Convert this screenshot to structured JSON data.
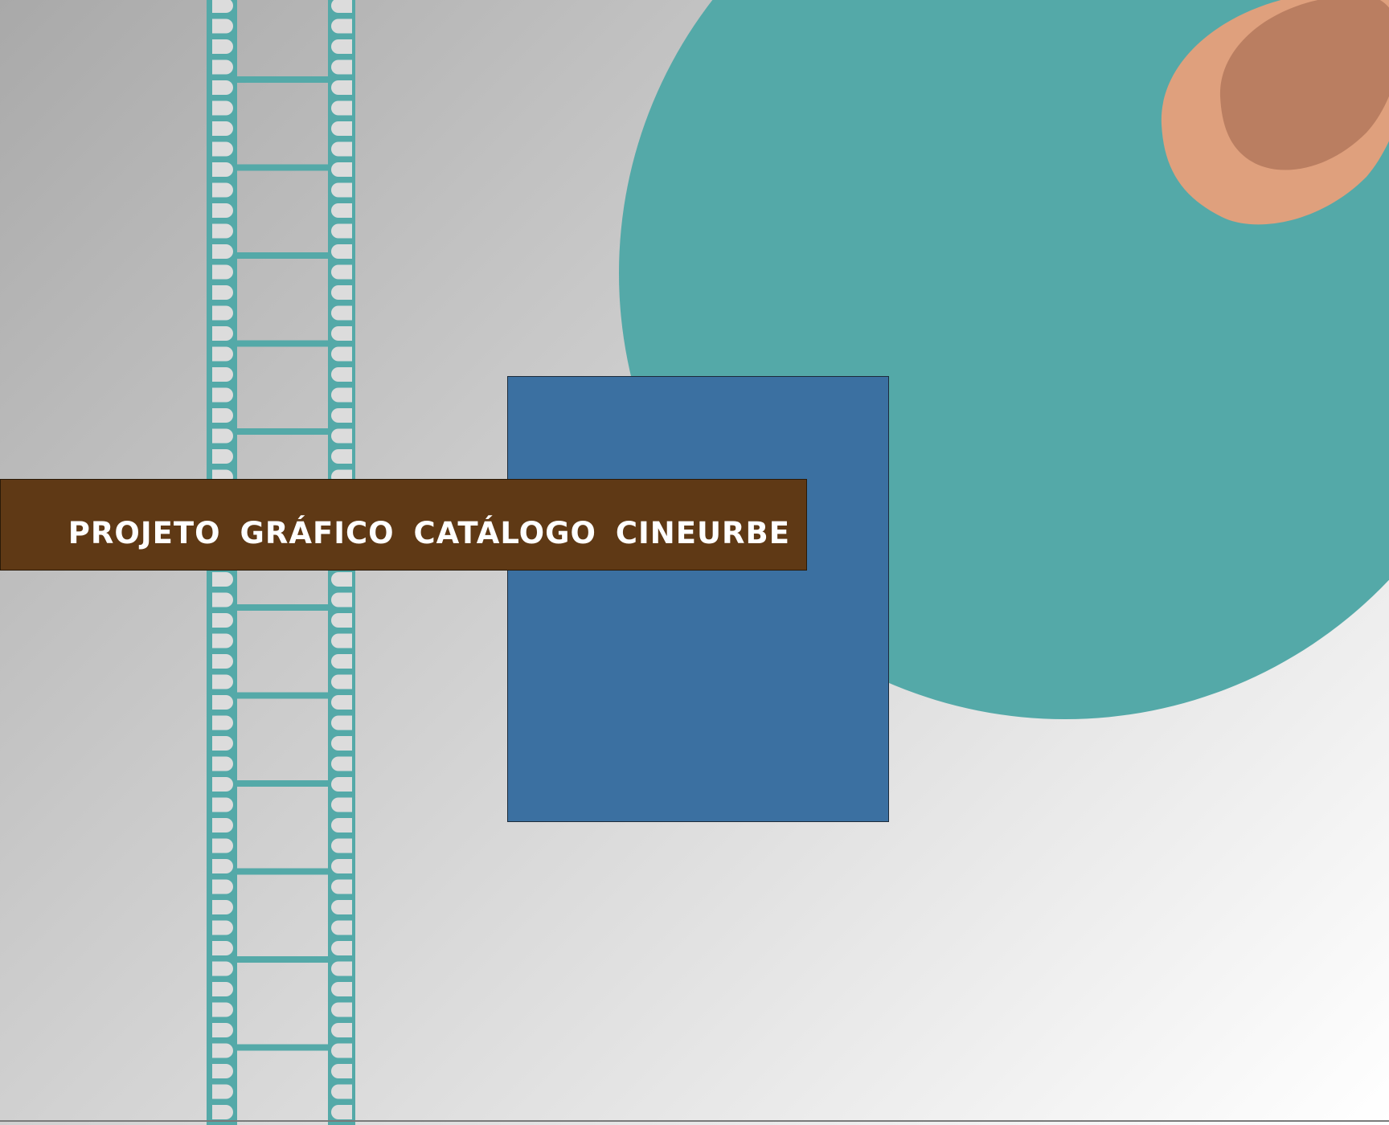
{
  "title": "PROJETO GRÁFICO CATÁLOGO CINEURBE",
  "colors": {
    "teal": "#54a9a8",
    "blue_panel": "#3b70a1",
    "title_bar": "#5f3915",
    "peach": "#dfa07d",
    "terracotta": "#ba7e61",
    "title_text": "#ffffff"
  },
  "decor": {
    "film_strip": "film-strip-icon",
    "large_circle": "circle-shape",
    "eye_shape": "eye-shape"
  }
}
